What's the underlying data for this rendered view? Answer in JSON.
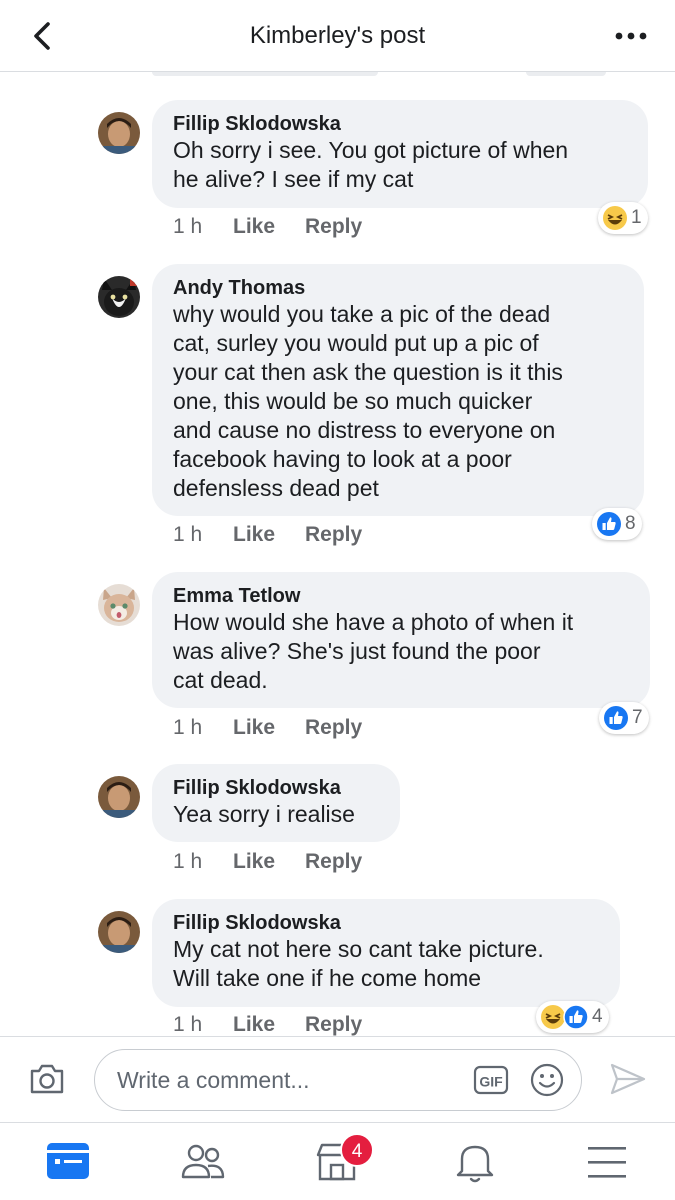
{
  "header": {
    "title": "Kimberley's post"
  },
  "colors": {
    "accent": "#1877f2",
    "bubble": "#f0f2f5",
    "meta": "#65676b",
    "badge": "#e41e3f"
  },
  "comments": [
    {
      "author": "Fillip Sklodowska",
      "text": "Oh sorry i see. You got picture of when\nhe alive? I see if my cat",
      "time": "1 h",
      "like": "Like",
      "reply": "Reply",
      "reactions": [
        "haha-icon"
      ],
      "reaction_count": "1"
    },
    {
      "author": "Andy Thomas",
      "text": "why would you take a pic of the dead\ncat, surley you would put up a pic of\nyour cat then ask the question is it this\none, this would be so much quicker\nand cause no distress to everyone on\nfacebook having to look at a poor\ndefensless dead pet",
      "time": "1 h",
      "like": "Like",
      "reply": "Reply",
      "reactions": [
        "like-icon"
      ],
      "reaction_count": "8"
    },
    {
      "author": "Emma Tetlow",
      "text": "How would she have a photo of when it\nwas alive? She's just found the poor\ncat dead.",
      "time": "1 h",
      "like": "Like",
      "reply": "Reply",
      "reactions": [
        "like-icon"
      ],
      "reaction_count": "7"
    },
    {
      "author": "Fillip Sklodowska",
      "text": "Yea sorry i realise",
      "time": "1 h",
      "like": "Like",
      "reply": "Reply",
      "reactions": [],
      "reaction_count": ""
    },
    {
      "author": "Fillip Sklodowska",
      "text": "My cat not here so cant take picture.\nWill take one if he come home",
      "time": "1 h",
      "like": "Like",
      "reply": "Reply",
      "reactions": [
        "haha-icon",
        "like-icon"
      ],
      "reaction_count": "4"
    }
  ],
  "composer": {
    "placeholder": "Write a comment...",
    "gif_label": "GIF"
  },
  "tabbar": {
    "items": [
      "news-feed-icon",
      "friends-icon",
      "marketplace-icon",
      "notifications-icon",
      "menu-icon"
    ],
    "marketplace_badge": "4"
  }
}
